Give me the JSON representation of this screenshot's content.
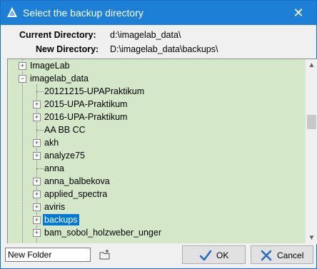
{
  "window": {
    "title": "Select the backup directory",
    "close_symbol": "✕"
  },
  "info": {
    "current_label": "Current Directory:",
    "current_value": "d:\\imagelab_data\\",
    "new_label": "New Directory:",
    "new_value": "D:\\imagelab_data\\backups\\"
  },
  "tree": {
    "items": [
      {
        "label": "ImageLab",
        "expander": "+"
      },
      {
        "label": "imagelab_data",
        "expander": "−"
      },
      {
        "label": "20121215-UPAPraktikum",
        "expander": ""
      },
      {
        "label": "2015-UPA-Praktikum",
        "expander": "+"
      },
      {
        "label": "2016-UPA-Praktikum",
        "expander": "+"
      },
      {
        "label": "AA BB CC",
        "expander": ""
      },
      {
        "label": "akh",
        "expander": "+"
      },
      {
        "label": "analyze75",
        "expander": "+"
      },
      {
        "label": "anna",
        "expander": ""
      },
      {
        "label": "anna_balbekova",
        "expander": "+"
      },
      {
        "label": "applied_spectra",
        "expander": "+"
      },
      {
        "label": "aviris",
        "expander": "+"
      },
      {
        "label": "backups",
        "expander": "+",
        "selected": true
      },
      {
        "label": "bam_sobol_holzweber_unger",
        "expander": "+"
      }
    ],
    "background_color": "#d4e7c8",
    "selection_color": "#0078d7"
  },
  "scrollbar": {
    "up_symbol": "▲",
    "down_symbol": "▼"
  },
  "bottom": {
    "new_folder_value": "New Folder",
    "new_folder_icon": "new-folder-icon",
    "ok_label": "OK",
    "cancel_label": "Cancel",
    "ok_icon": "checkmark-icon",
    "cancel_icon": "x-icon"
  },
  "colors": {
    "titlebar": "#1e7fd6",
    "ok_check": "#2b6cc4",
    "cancel_x": "#2b6cc4"
  }
}
